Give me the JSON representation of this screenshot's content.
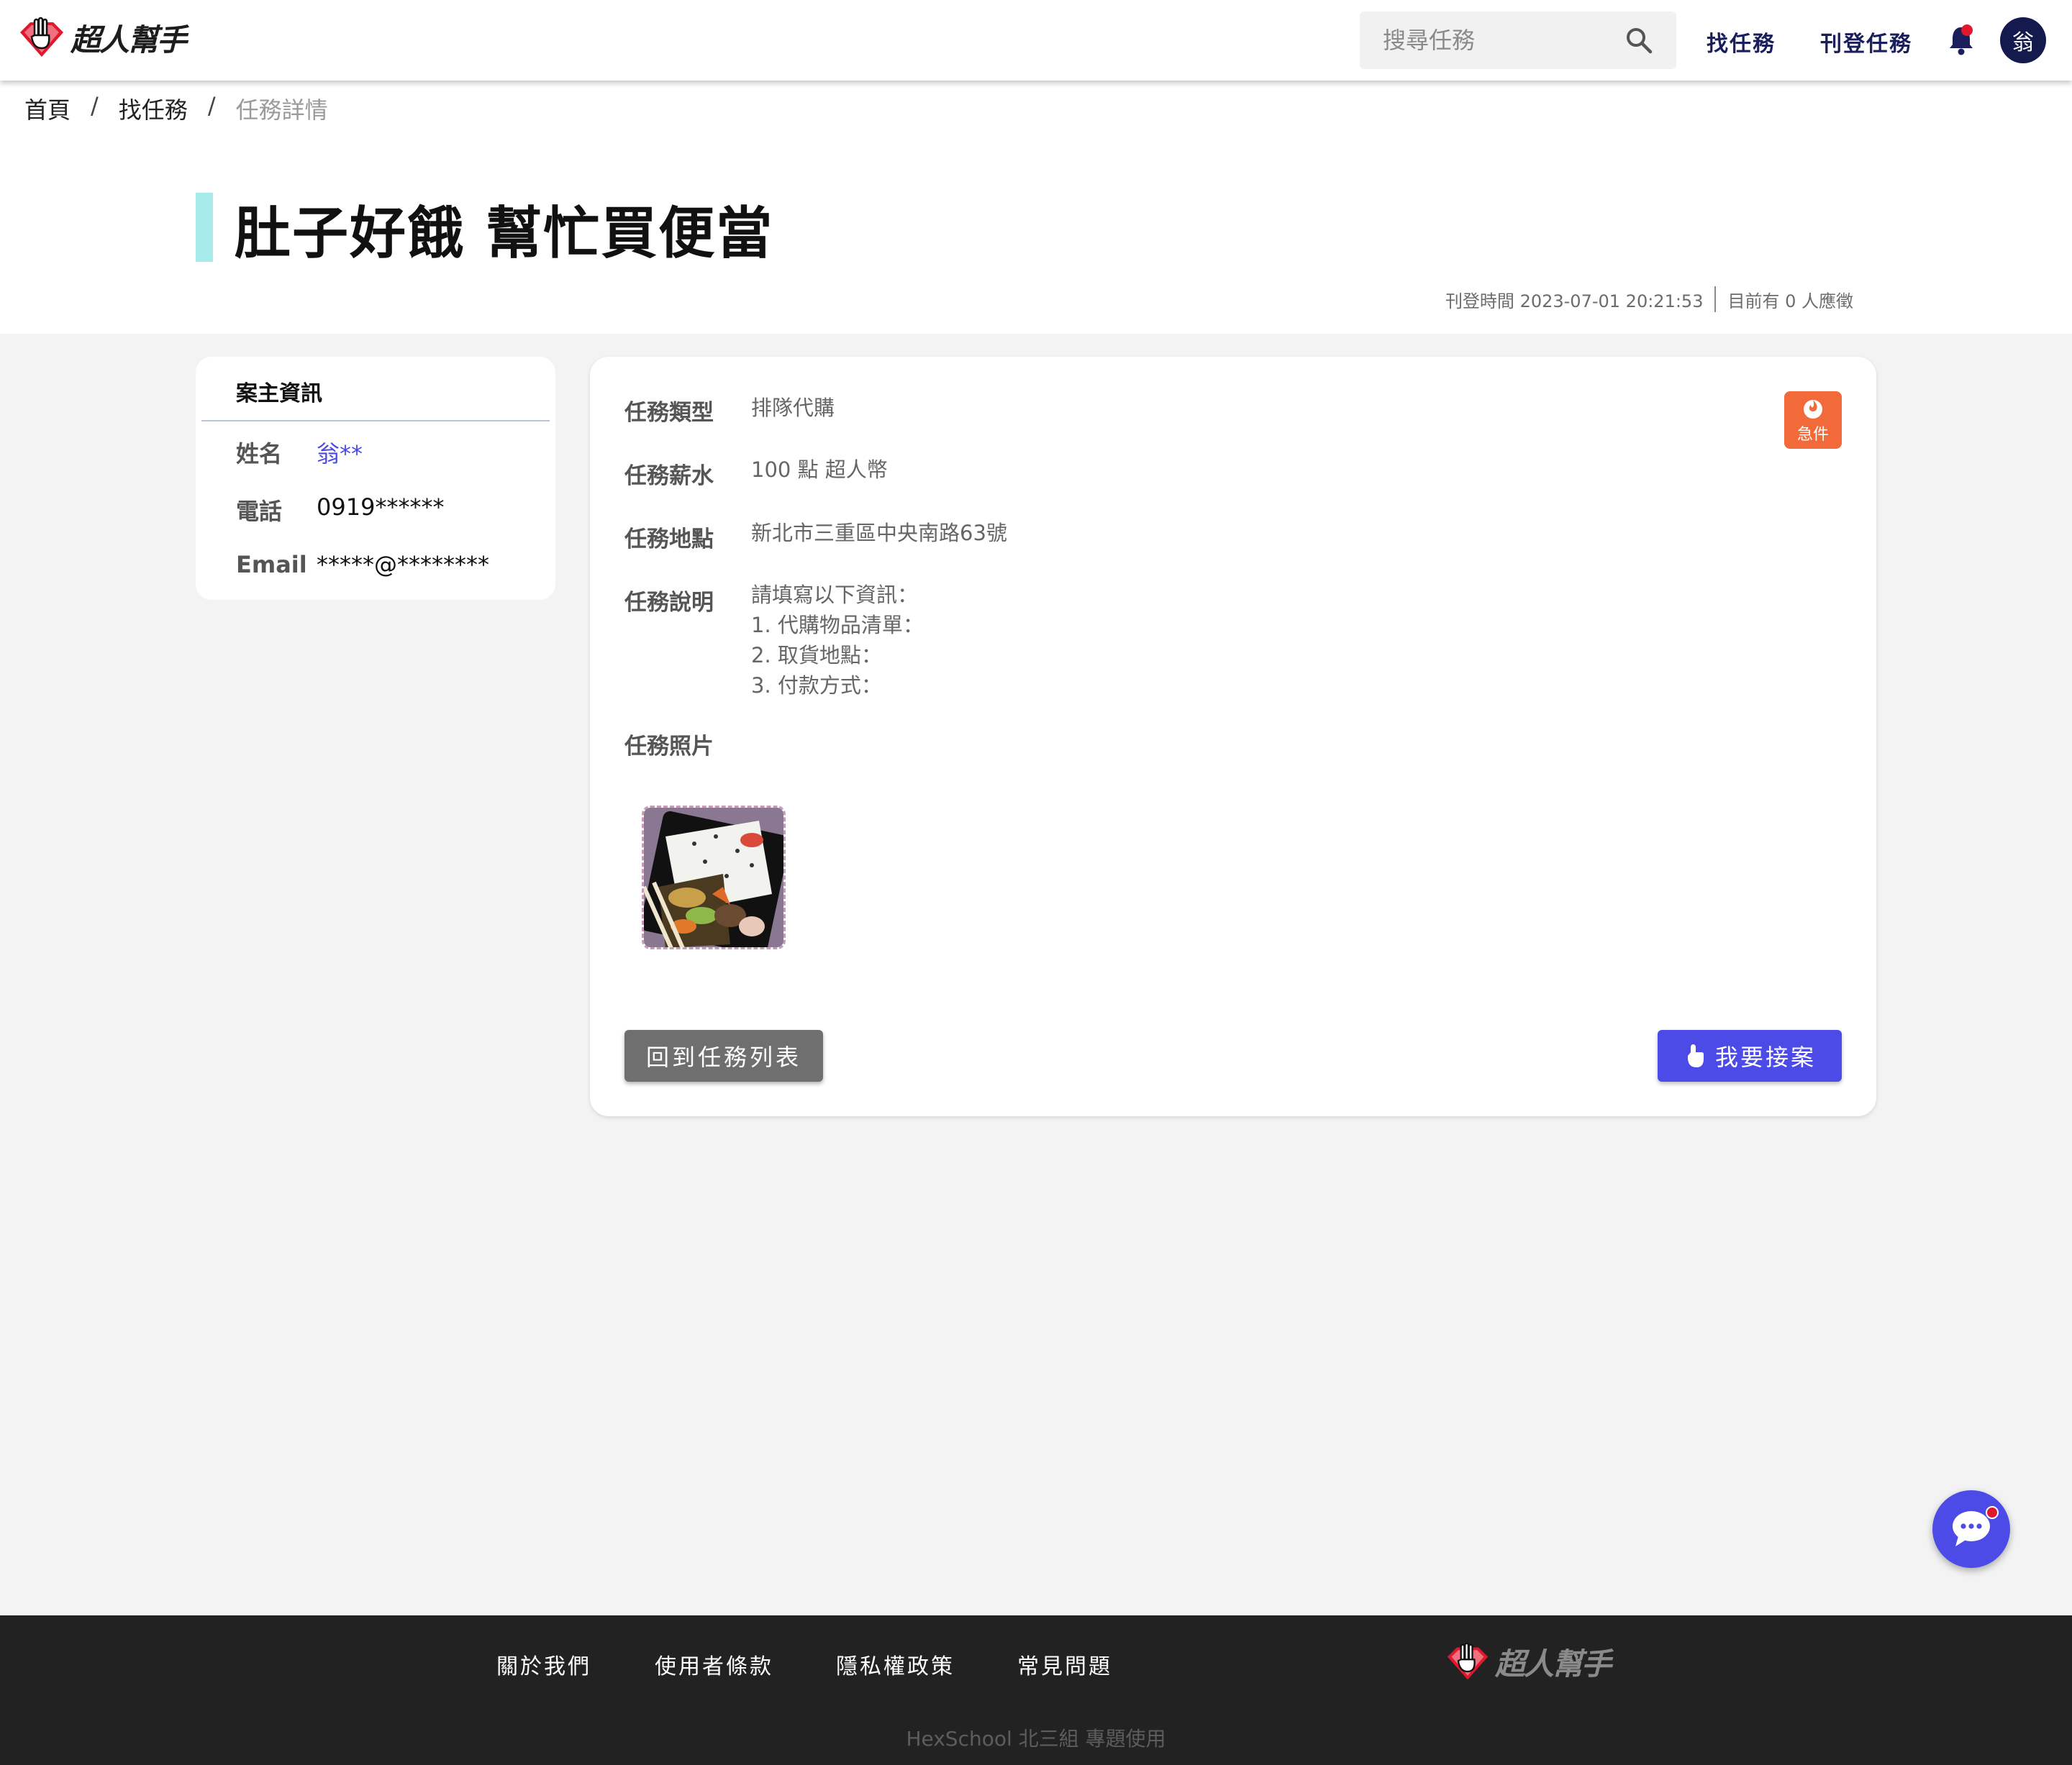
{
  "header": {
    "logo_text": "超人幫手",
    "search_placeholder": "搜尋任務",
    "nav": [
      "找任務",
      "刊登任務"
    ],
    "avatar_text": "翁"
  },
  "breadcrumb": [
    "首頁",
    "找任務",
    "任務詳情"
  ],
  "task": {
    "title": "肚子好餓 幫忙買便當",
    "posted_label": "刊登時間 2023-07-01 20:21:53",
    "applicants_label": "目前有 0 人應徵",
    "urgent_label": "急件",
    "rows": {
      "type": {
        "label": "任務類型",
        "value": "排隊代購"
      },
      "salary": {
        "label": "任務薪水",
        "value": "100 點 超人幣"
      },
      "location": {
        "label": "任務地點",
        "value": "新北市三重區中央南路63號"
      },
      "description": {
        "label": "任務說明",
        "lines": [
          "請填寫以下資訊：",
          "1. 代購物品清單：",
          "2. 取貨地點：",
          "3. 付款方式："
        ]
      },
      "photos": {
        "label": "任務照片"
      }
    },
    "back_button": "回到任務列表",
    "accept_button": "我要接案"
  },
  "owner": {
    "title": "案主資訊",
    "name_label": "姓名",
    "name_value": "翁**",
    "phone_label": "電話",
    "phone_value": "0919******",
    "email_label": "Email",
    "email_value": "*****@********"
  },
  "footer": {
    "links": [
      "關於我們",
      "使用者條款",
      "隱私權政策",
      "常見問題"
    ],
    "logo_text": "超人幫手",
    "copyright": "HexSchool 北三組 專題使用"
  },
  "colors": {
    "accent": "#4c4be8",
    "nav_text": "#1a1f5c",
    "title_bar": "#a8ebeb",
    "urgent": "#f26a3a",
    "footer_bg": "#222222"
  }
}
